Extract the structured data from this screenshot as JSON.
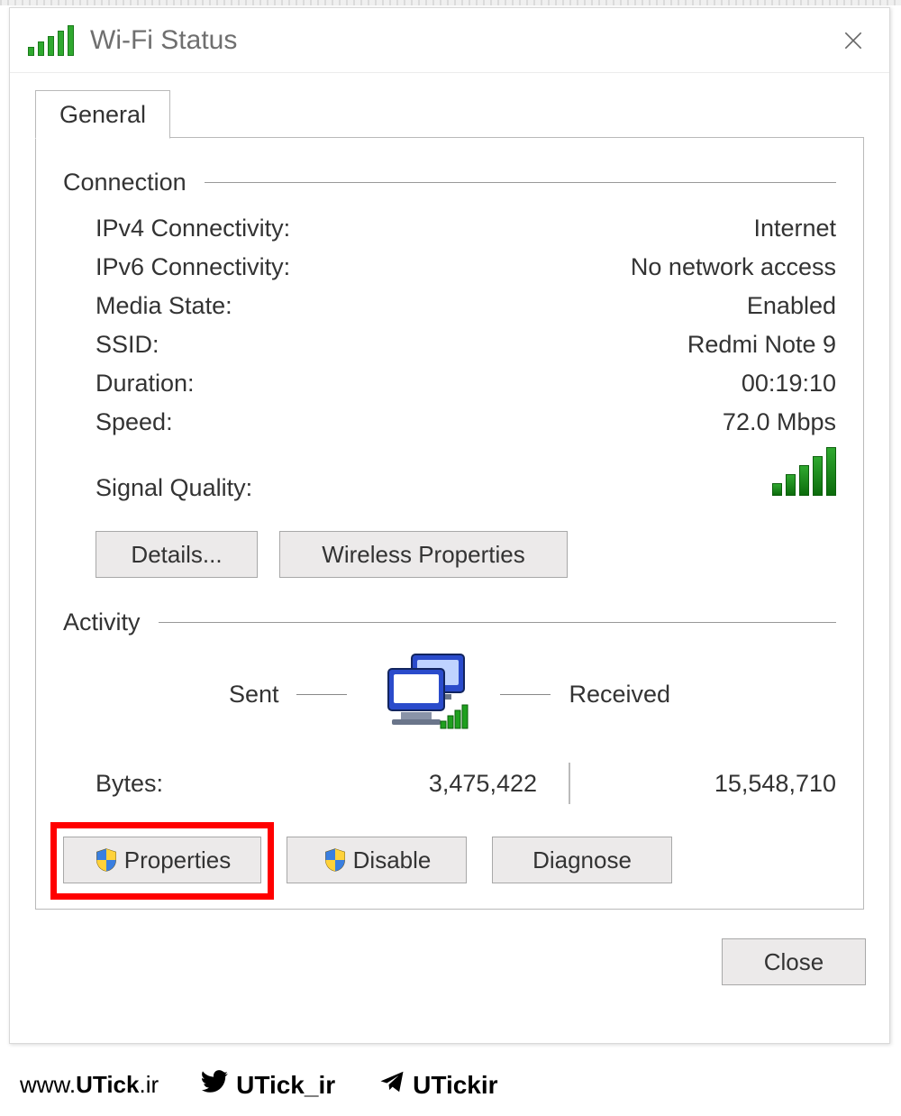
{
  "window_title": "Wi-Fi Status",
  "tab_general": "General",
  "group_connection": "Connection",
  "group_activity": "Activity",
  "connection": {
    "ipv4_label": "IPv4 Connectivity:",
    "ipv4_value": "Internet",
    "ipv6_label": "IPv6 Connectivity:",
    "ipv6_value": "No network access",
    "media_label": "Media State:",
    "media_value": "Enabled",
    "ssid_label": "SSID:",
    "ssid_value": "Redmi Note 9",
    "duration_label": "Duration:",
    "duration_value": "00:19:10",
    "speed_label": "Speed:",
    "speed_value": "72.0 Mbps",
    "signal_label": "Signal Quality:"
  },
  "buttons": {
    "details": "Details...",
    "wireless_properties": "Wireless Properties",
    "properties": "Properties",
    "disable": "Disable",
    "diagnose": "Diagnose",
    "close": "Close"
  },
  "activity": {
    "sent_label": "Sent",
    "received_label": "Received",
    "bytes_label": "Bytes:",
    "bytes_sent": "3,475,422",
    "bytes_received": "15,548,710"
  },
  "footer": {
    "site_prefix": "www.",
    "site_bold": "UTick",
    "site_suffix": ".ir",
    "twitter": "UTick_ir",
    "telegram": "UTickir"
  }
}
